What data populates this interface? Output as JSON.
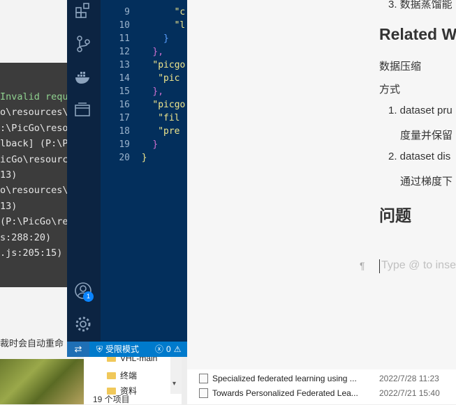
{
  "terminal": {
    "lines": [
      "Invalid requ",
      "o\\resources\\",
      ":\\PicGo\\reso",
      "lback] (P:\\P",
      "icGo\\resource",
      "13)",
      "o\\resources\\",
      "13)",
      "(P:\\PicGo\\re",
      "s:288:20)",
      ".js:205:15)"
    ]
  },
  "background": {
    "truncated_cn_text": "裁时会自动重命",
    "folders": [
      "VHL-main",
      "终端",
      "资料"
    ],
    "items_count": "19 个项目",
    "files": [
      {
        "name": "Specialized federated learning using ...",
        "date": "2022/7/28 11:23"
      },
      {
        "name": "Towards Personalized Federated Lea...",
        "date": "2022/7/21 15:40"
      }
    ]
  },
  "vscode": {
    "line_numbers": [
      "9",
      "10",
      "11",
      "12",
      "13",
      "14",
      "15",
      "16",
      "17",
      "18",
      "19",
      "20"
    ],
    "code_lines": [
      {
        "indent": 7,
        "text": "\"c",
        "color": "#f0e68c"
      },
      {
        "indent": 7,
        "text": "\"l",
        "color": "#f0e68c"
      },
      {
        "indent": 5,
        "text": "}",
        "color": "#5aa0ff"
      },
      {
        "indent": 3,
        "text": "},",
        "color": "#d070d0"
      },
      {
        "indent": 3,
        "text": "\"picgo",
        "color": "#f0e68c"
      },
      {
        "indent": 4,
        "text": "\"pic",
        "color": "#f0e68c"
      },
      {
        "indent": 3,
        "text": "},",
        "color": "#d070d0"
      },
      {
        "indent": 3,
        "text": "\"picgo",
        "color": "#f0e68c"
      },
      {
        "indent": 4,
        "text": "\"fil",
        "color": "#f0e68c"
      },
      {
        "indent": 4,
        "text": "\"pre",
        "color": "#f0e68c"
      },
      {
        "indent": 3,
        "text": "}",
        "color": "#d070d0"
      },
      {
        "indent": 1,
        "text": "}",
        "color": "#f0e68c"
      }
    ],
    "status": {
      "restricted_label": "受限模式",
      "errors": "0",
      "notification_badge": "1"
    }
  },
  "document": {
    "top_list_item": "3. 数据蒸馏能",
    "heading_related": "Related W",
    "para_compression": "数据压缩",
    "para_method": "方式",
    "list_item_1": "1. dataset pru",
    "list_item_1_cont": "度量并保留",
    "list_item_2": "2. dataset dis",
    "list_item_2_cont": "通过梯度下",
    "heading_problem": "问题",
    "input_placeholder": "Type @ to inse",
    "paragraph_mark": "¶"
  }
}
